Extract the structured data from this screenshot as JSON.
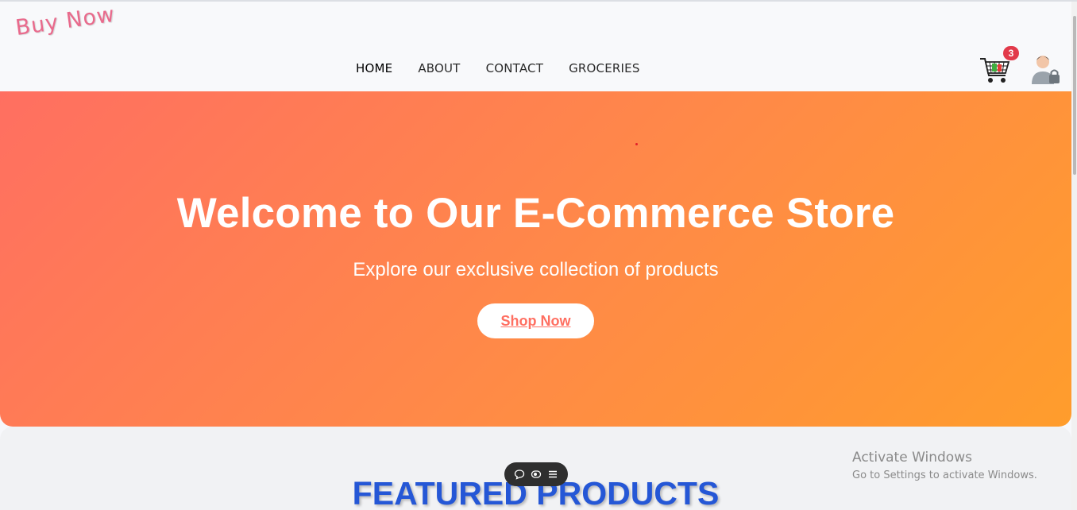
{
  "brand": {
    "logo_text": "Buy Now"
  },
  "nav": {
    "items": [
      {
        "label": "HOME"
      },
      {
        "label": "ABOUT"
      },
      {
        "label": "CONTACT"
      },
      {
        "label": "GROCERIES"
      }
    ]
  },
  "cart": {
    "count": "3"
  },
  "hero": {
    "title": "Welcome to Our E-Commerce Store",
    "subtitle": "Explore our exclusive collection of products",
    "button_label": "Shop Now"
  },
  "featured": {
    "title": "FEATURED PRODUCTS"
  },
  "watermark": {
    "line1": "Activate Windows",
    "line2": "Go to Settings to activate Windows."
  },
  "colors": {
    "hero_start": "#ff6f61",
    "hero_end": "#ff9d2c",
    "featured_title": "#2557d6",
    "badge": "#e23a4a",
    "logo": "#e96a8c"
  }
}
